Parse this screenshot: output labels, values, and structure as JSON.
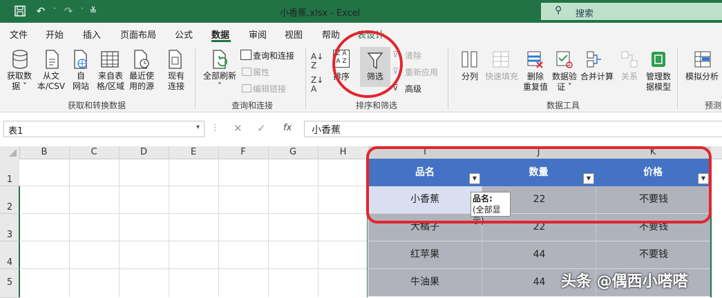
{
  "title_bar": {
    "title": "小香蕉.xlsx  -  Excel",
    "search_placeholder": "搜索",
    "quick_access": [
      "save-icon",
      "undo-icon",
      "redo-icon",
      "customize-icon"
    ]
  },
  "menu": {
    "tabs": [
      "文件",
      "开始",
      "插入",
      "页面布局",
      "公式",
      "数据",
      "审阅",
      "视图",
      "帮助",
      "表设计"
    ],
    "active_tab": "数据"
  },
  "ribbon": {
    "get_transform": {
      "group_label": "获取和转换数据",
      "buttons": [
        {
          "label": "获取数\n据 ˅",
          "icon": "database-icon"
        },
        {
          "label": "从文\n本/CSV",
          "icon": "text-file-icon"
        },
        {
          "label": "自\n网站",
          "icon": "web-icon"
        },
        {
          "label": "来自表\n格/区域",
          "icon": "table-icon"
        },
        {
          "label": "最近使\n用的源",
          "icon": "recent-source-icon"
        },
        {
          "label": "现有\n连接",
          "icon": "connection-icon"
        }
      ]
    },
    "queries": {
      "group_label": "查询和连接",
      "refresh_label": "全部刷新\n˅",
      "items": [
        "查询和连接",
        "属性",
        "编辑链接"
      ]
    },
    "sort_filter": {
      "group_label": "排序和筛选",
      "sort_label": "排序",
      "filter_label": "筛选",
      "clear_label": "清除",
      "reapply_label": "重新应用",
      "advanced_label": "高级"
    },
    "data_tools": {
      "group_label": "数据工具",
      "buttons": [
        {
          "label": "分列",
          "dim": false
        },
        {
          "label": "快速填充",
          "dim": true
        },
        {
          "label": "删除\n重复值",
          "dim": false
        },
        {
          "label": "数据验\n证 ˅",
          "dim": false
        },
        {
          "label": "合并计算",
          "dim": false
        },
        {
          "label": "关系",
          "dim": true
        },
        {
          "label": "管理数\n据模型",
          "dim": false
        }
      ]
    },
    "forecast": {
      "group_label": "预测",
      "what_if_label": "模拟分析"
    }
  },
  "formula_bar": {
    "name_box": "表1",
    "formula": "小香蕉"
  },
  "grid": {
    "columns": [
      "B",
      "C",
      "D",
      "E",
      "F",
      "G",
      "H",
      "I",
      "J",
      "K"
    ],
    "rows": [
      "1",
      "2",
      "3",
      "4",
      "5"
    ],
    "table_headers": [
      "品名",
      "数量",
      "价格"
    ],
    "table_rows": [
      [
        "小香蕉",
        "22",
        "不要钱"
      ],
      [
        "大橘子",
        "22",
        "不要钱"
      ],
      [
        "红苹果",
        "44",
        "不要钱"
      ],
      [
        "牛油果",
        "44",
        ""
      ]
    ]
  },
  "tooltip": {
    "title": "品名:",
    "body": "(全部显示)"
  },
  "watermark": "头条 @偶西小嗒嗒",
  "colors": {
    "excel_green": "#217346",
    "header_blue": "#4472c4",
    "annotation_red": "#e0262f"
  }
}
